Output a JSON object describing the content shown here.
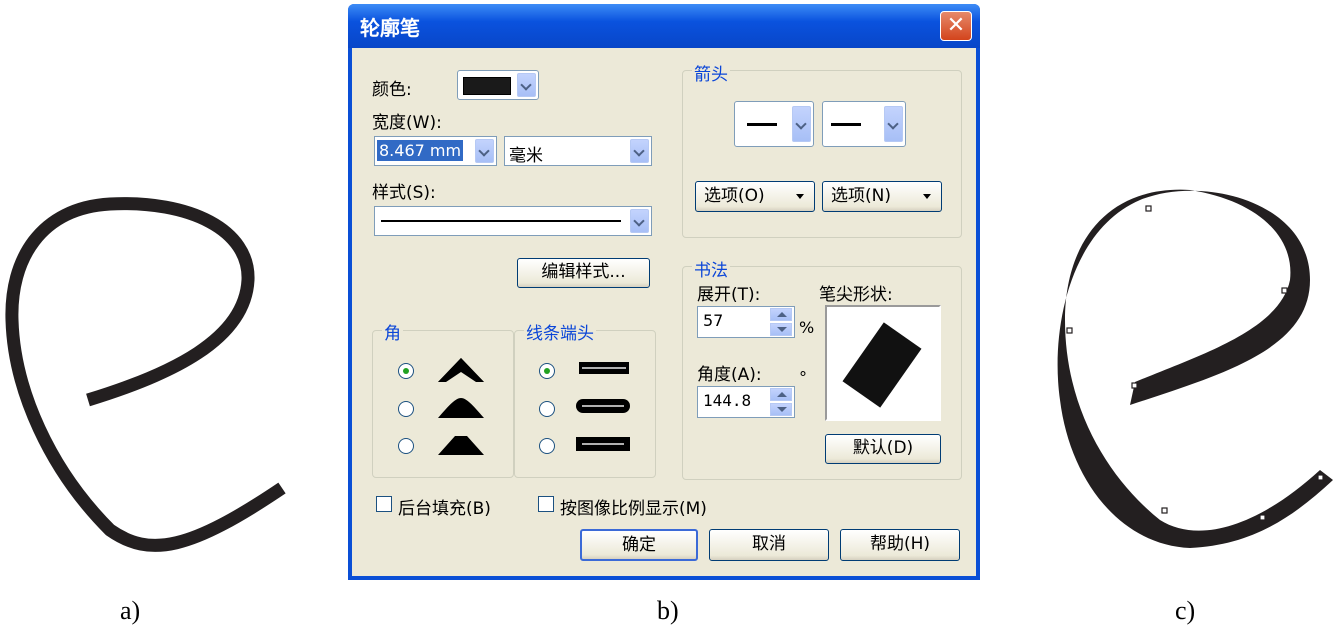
{
  "captions": {
    "a": "a)",
    "b": "b)",
    "c": "c)"
  },
  "dialog": {
    "title": "轮廓笔",
    "close_glyph": "✕",
    "color_label": "颜色:",
    "color_value": "#1a1a1a",
    "width_label": "宽度(W):",
    "width_value": "8.467 mm",
    "unit_value": "毫米",
    "style_label": "样式(S):",
    "edit_style_button": "编辑样式...",
    "arrows": {
      "label": "箭头",
      "options1": "选项(O)",
      "options2": "选项(N)"
    },
    "corners": {
      "label": "角",
      "selected_index": 0
    },
    "line_caps": {
      "label": "线条端头",
      "selected_index": 0
    },
    "calligraphy": {
      "label": "书法",
      "stretch_label": "展开(T):",
      "stretch_value": "57",
      "stretch_unit": "%",
      "angle_label": "角度(A):",
      "angle_value": "144.8",
      "angle_unit": "°",
      "nib_shape_label": "笔尖形状:",
      "default_button": "默认(D)"
    },
    "behind_fill": {
      "label": "后台填充(B)",
      "checked": false
    },
    "scale_with_image": {
      "label": "按图像比例显示(M)",
      "checked": false
    },
    "ok_button": "确定",
    "cancel_button": "取消",
    "help_button": "帮助(H)"
  }
}
